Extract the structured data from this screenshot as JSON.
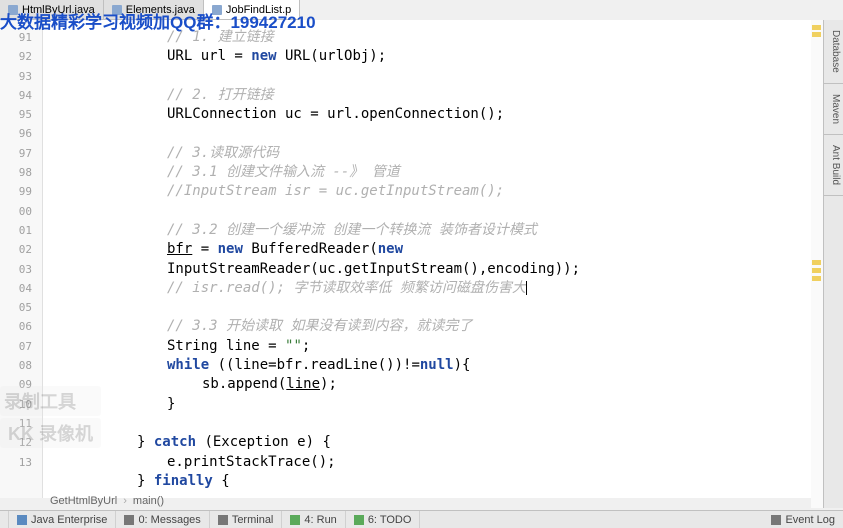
{
  "banner": "大数据精彩学习视频加QQ群：199427210",
  "tabs": [
    {
      "label": "HtmlByUrl.java",
      "active": false
    },
    {
      "label": "Elements.java",
      "active": false
    },
    {
      "label": "JobFindList.p",
      "active": true
    }
  ],
  "watermark": {
    "line1": "录制工具",
    "line2": "KK 录像机"
  },
  "right_panels": [
    "Database",
    "Maven",
    "Ant Build"
  ],
  "breadcrumb": [
    "GetHtmlByUrl",
    "main()"
  ],
  "line_numbers": [
    "91",
    "92",
    "93",
    "94",
    "95",
    "96",
    "97",
    "98",
    "99",
    "00",
    "01",
    "02",
    "03",
    "04",
    "05",
    "06",
    "07",
    "08",
    "09",
    "10",
    "11",
    "12",
    "13"
  ],
  "code": {
    "l91": "// 1. 建立链接",
    "l92_a": "URL url = ",
    "l92_new": "new",
    "l92_b": " URL(urlObj);",
    "l93": "",
    "l94": "// 2. 打开链接",
    "l95": "URLConnection uc = url.openConnection();",
    "l96": "",
    "l97": "// 3.读取源代码",
    "l98": "// 3.1 创建文件输入流 --》 管道",
    "l99": "//InputStream isr = uc.getInputStream();",
    "l100": "",
    "l101": "// 3.2 创建一个缓冲流 创建一个转换流 装饰者设计模式",
    "l102_a": "bfr",
    "l102_b": " = ",
    "l102_new1": "new",
    "l102_c": " BufferedReader(",
    "l102_new2": "new",
    "l102_d": " InputStreamReader(uc.getInputStream(),encoding));",
    "l103": "// isr.read(); 字节读取效率低 频繁访问磁盘伤害大",
    "l104": "",
    "l105": "// 3.3 开始读取 如果没有读到内容，就读完了",
    "l106_a": "String line = ",
    "l106_str": "\"\"",
    "l106_b": ";",
    "l107_while": "while",
    "l107_a": " ((line=bfr.readLine())!=",
    "l107_null": "null",
    "l107_b": "){",
    "l108_a": "sb.append(",
    "l108_line": "line",
    "l108_b": ");",
    "l109": "}",
    "l110": "",
    "l111_a": "} ",
    "l111_catch": "catch",
    "l111_b": " (Exception e) {",
    "l112": "e.printStackTrace();",
    "l113_a": "} ",
    "l113_finally": "finally",
    "l113_b": " {"
  },
  "statusbar": {
    "java_enterprise": "Java Enterprise",
    "messages": "0: Messages",
    "terminal": "Terminal",
    "run": "4: Run",
    "todo": "6: TODO",
    "event_log": "Event Log"
  }
}
